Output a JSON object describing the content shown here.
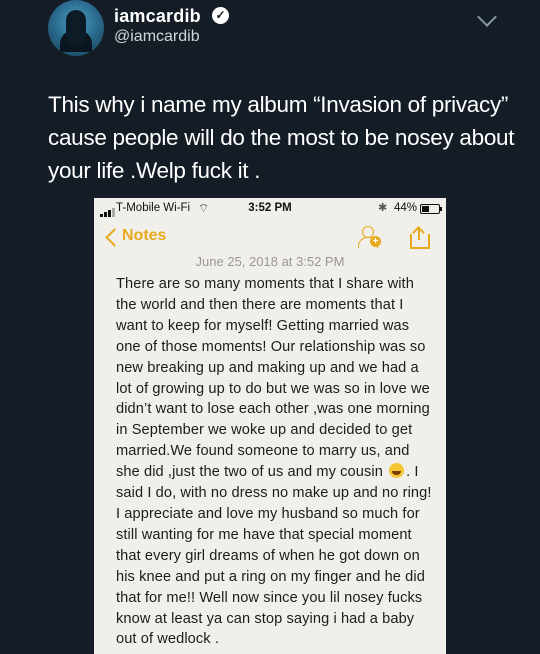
{
  "tweet": {
    "display_name": "iamcardib",
    "handle": "@iamcardib",
    "text": "This why i name my album “Invasion of privacy” cause people will do the most to be nosey about your life .Welp fuck it ."
  },
  "status_bar": {
    "carrier": "T-Mobile Wi-Fi",
    "time": "3:52 PM",
    "battery": "44%"
  },
  "notes": {
    "back_label": "Notes",
    "date": "June 25, 2018 at 3:52 PM",
    "body_part1": "There are so many moments that I share with the world and then there are moments that I want to keep for myself! Getting married was one of those moments! Our relationship was so new breaking up and making up and we had a lot of growing up to do but we was so in love we didn’t want to lose each other ,was one morning in September we woke up and decided to get married.We found someone to marry us, and she did ,just the two of us and my cousin",
    "emoji": "laughing-emoji",
    "body_part2": ". I said I do, with no dress no make up and no ring! I appreciate and love my husband so much for still wanting for me have that special moment that every girl dreams of when he got down on his knee and put a ring on my finger and he did that for me!! Well now since you lil nosey fucks know at least ya can stop saying i had a baby out of wedlock ."
  },
  "colors": {
    "background": "#141d26",
    "notes_paper": "#f0efe9",
    "notes_accent": "#e7a91e"
  }
}
